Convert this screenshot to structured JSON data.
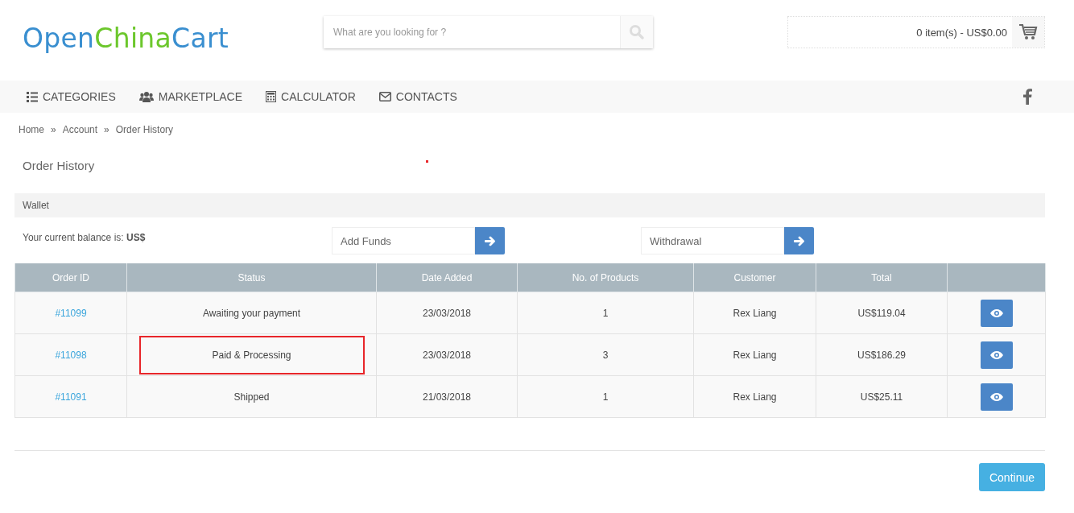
{
  "logo": [
    {
      "text": "Open",
      "color": "#3a8fd0"
    },
    {
      "text": "China",
      "color": "#6cc72c"
    },
    {
      "text": "Cart",
      "color": "#3a8fd0"
    }
  ],
  "search": {
    "placeholder": "What are you looking for ?"
  },
  "cart": {
    "summary": "0 item(s) - US$0.00"
  },
  "nav": [
    {
      "label": "CATEGORIES",
      "kind": "list"
    },
    {
      "label": "MARKETPLACE",
      "kind": "users"
    },
    {
      "label": "CALCULATOR",
      "kind": "calculator"
    },
    {
      "label": "CONTACTS",
      "kind": "envelope"
    }
  ],
  "breadcrumb": [
    "Home",
    "Account",
    "Order History"
  ],
  "breadcrumb_separator": "»",
  "page_title": "Order History",
  "wallet": {
    "title": "Wallet",
    "balance_label": "Your current balance is: **US$**",
    "add_funds": {
      "placeholder": "Add Funds"
    },
    "withdrawal": {
      "placeholder": "Withdrawal"
    }
  },
  "table": {
    "columns": [
      "Order ID",
      "Status",
      "Date Added",
      "No. of Products",
      "Customer",
      "Total"
    ],
    "rows": [
      {
        "order_id": "#11099",
        "status": "Awaiting your payment",
        "date": "23/03/2018",
        "products": "1",
        "customer": "Rex Liang",
        "total": "US$119.04",
        "highlighted": false
      },
      {
        "order_id": "#11098",
        "status": "Paid & Processing",
        "date": "23/03/2018",
        "products": "3",
        "customer": "Rex Liang",
        "total": "US$186.29",
        "highlighted": true
      },
      {
        "order_id": "#11091",
        "status": "Shipped",
        "date": "21/03/2018",
        "products": "1",
        "customer": "Rex Liang",
        "total": "US$25.11",
        "highlighted": false
      }
    ]
  },
  "continue_button": "Continue"
}
